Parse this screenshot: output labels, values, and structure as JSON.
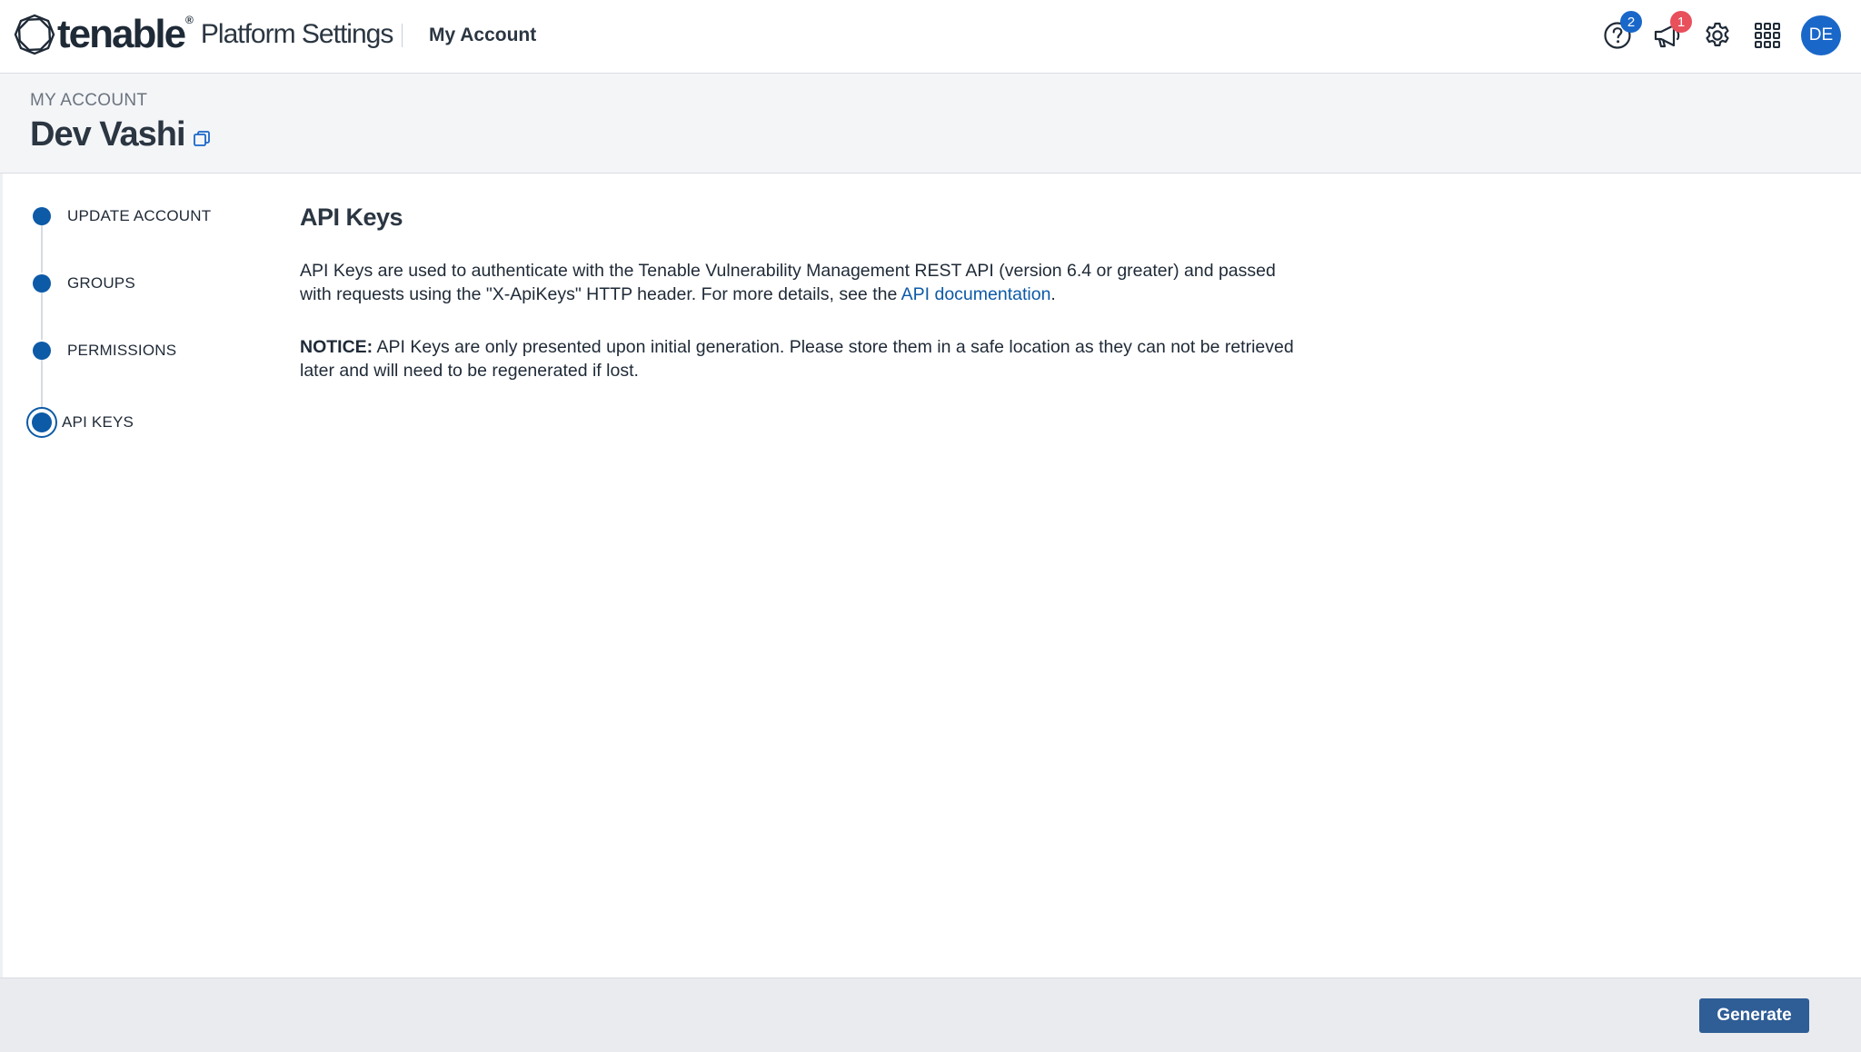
{
  "topbar": {
    "brand": "tenable",
    "brand_reg": "®",
    "product": "Platform Settings",
    "section": "My Account",
    "help_badge": "2",
    "notifications_badge": "1",
    "avatar_initials": "DE"
  },
  "header": {
    "eyebrow": "MY ACCOUNT",
    "title": "Dev Vashi"
  },
  "stepper": {
    "steps": [
      {
        "label": "UPDATE ACCOUNT",
        "active": false
      },
      {
        "label": "GROUPS",
        "active": false
      },
      {
        "label": "PERMISSIONS",
        "active": false
      },
      {
        "label": "API KEYS",
        "active": true
      }
    ]
  },
  "content": {
    "title": "API Keys",
    "intro_before": "API Keys are used to authenticate with the Tenable Vulnerability Management REST API (version 6.4 or greater) and passed with requests using the \"X-ApiKeys\" HTTP header. For more details, see the ",
    "intro_link": "API documentation",
    "intro_after": ".",
    "notice_label": "NOTICE:",
    "notice_text": " API Keys are only presented upon initial generation. Please store them in a safe location as they can not be retrieved later and will need to be regenerated if lost."
  },
  "footer": {
    "generate_label": "Generate"
  },
  "colors": {
    "primary": "#0d5aa7",
    "badge_blue": "#1967c9",
    "badge_red": "#e8505b",
    "button": "#2f5d96"
  },
  "icons": [
    "tenable-logo-icon",
    "copy-icon",
    "help-icon",
    "megaphone-icon",
    "gear-icon",
    "app-grid-icon"
  ]
}
